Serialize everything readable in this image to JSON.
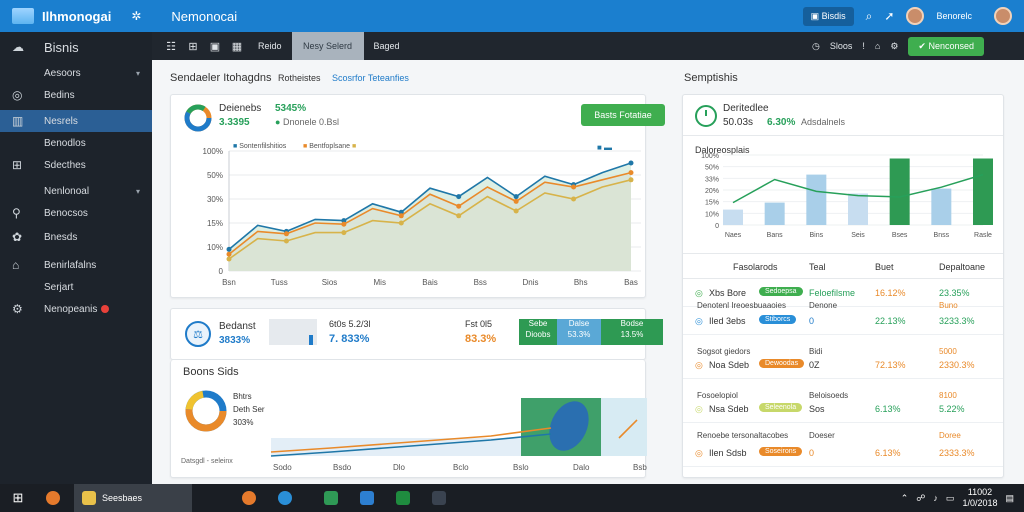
{
  "titlebar": {
    "app_name": "Ilhmonogai",
    "window_title": "Nemonocai",
    "button_label": "Bisdis",
    "user_label": "Benorelc"
  },
  "sidebar": {
    "header": "Bisnis",
    "items": [
      {
        "label": "Aesoors"
      },
      {
        "label": "Bedins"
      },
      {
        "label": "Nesrels"
      },
      {
        "label": "Benodlos"
      },
      {
        "label": "Sdecthes"
      },
      {
        "label": "Nenlonoal"
      },
      {
        "label": "Benocsos"
      },
      {
        "label": "Bnesds"
      },
      {
        "label": "Benirlafalns"
      },
      {
        "label": "Serjart"
      },
      {
        "label": "Nenopeanis"
      }
    ]
  },
  "toolbar": {
    "tabs": [
      "Reido",
      "Nesy Selerd",
      "Baged"
    ],
    "right_label": "Sloos",
    "green_button": "Nenconsed"
  },
  "main": {
    "section_title": "Sendaeler Itohagdns",
    "section_link_1": "Rotheistes",
    "section_link_2": "Scosrfor Teteanfies",
    "chart_card": {
      "stat_title": "Deienebs",
      "stat_value": "5345%",
      "stat_value_2": "3.3395",
      "stat_note": "Dnonele 0.Bsl",
      "button_label": "Basts Fotatiae",
      "legend_1": "Sontenfilshitios",
      "legend_2": "Bentfoplsane"
    },
    "kpi_card": {
      "title": "Bedanst",
      "value": "3833%",
      "mid_label": "6t0s 5.2/3l",
      "mid_value": "7. 833%",
      "right_label": "Fst 0l5",
      "right_value": "83.3%",
      "tile_1": "Dioobs",
      "tile_2": "53.3%",
      "tile_3": "13.5%",
      "tile_1_top": "Sebe",
      "tile_2_top": "Dalse",
      "tile_3_top": "Bodse"
    },
    "lower_card": {
      "title": "Boons Sids",
      "donut_label_1": "Bhtrs",
      "donut_label_2": "Deth Ser",
      "donut_value": "303%",
      "axis_note": "Datsgdl - seleinx"
    }
  },
  "right_panel": {
    "title": "Semptishis",
    "stat_title": "Deritedlee",
    "stat_value": "50.03s",
    "stat_green": "6.30%",
    "stat_note": "Adsdalnels",
    "chart_title": "Daloreosplais",
    "table_headers": [
      "Fasolarods",
      "Teal",
      "Buet",
      "Depaltoane"
    ],
    "rows": [
      {
        "name": "Xbs Bore",
        "pill": "Sedoepsa",
        "status": "Feloefilsme",
        "val": "16.12%",
        "pct": "23.35%"
      },
      {
        "name": "Iled 3ebs",
        "pill": "Stiborcs",
        "status": "0",
        "val": "22.13%",
        "pct": "3233.3%"
      },
      {
        "name": "Noa Sdeb",
        "pill": "Dewoodas",
        "status": "0Z",
        "val": "72.13%",
        "pct": "2330.3%"
      },
      {
        "name": "Nsa Sdeb",
        "pill": "Seleenola",
        "status": "Sos",
        "val": "6.13%",
        "pct": "5.22%"
      },
      {
        "name": "Ilen Sdsb",
        "pill": "Soseirons",
        "status": "0",
        "val": "6.13%",
        "pct": "2333.3%"
      }
    ],
    "row_headers": [
      "Denotenl Ireoesbuaaoies",
      "Sogsot giedors",
      "Fosoelopiol",
      "Renoebe tersonaltacobes"
    ],
    "row_headers_2": [
      "Denone",
      "Bidi",
      "Beloisoeds",
      "Doeser"
    ],
    "row_headers_3": [
      "Buno",
      "5000",
      "8100",
      "Doree"
    ]
  },
  "chart_data": [
    {
      "type": "area",
      "x": [
        "Bsn",
        "Tuss",
        "Sios",
        "Mis",
        "Bais",
        "Bss",
        "Dnis",
        "Bhs",
        "Bas"
      ],
      "ylim": [
        0,
        1000
      ],
      "yticks": [
        "0",
        "10%",
        "15%",
        "30%",
        "50%",
        "100%"
      ],
      "series": [
        {
          "name": "Sontenfilshitios",
          "color": "#1f77a8",
          "values": [
            180,
            380,
            330,
            430,
            420,
            560,
            490,
            690,
            620,
            780,
            620,
            790,
            720,
            820,
            900
          ]
        },
        {
          "name": "Bentfoplsane",
          "color": "#e98a2a",
          "values": [
            140,
            330,
            310,
            400,
            390,
            520,
            460,
            640,
            540,
            700,
            580,
            740,
            700,
            760,
            820
          ]
        },
        {
          "name": "",
          "color": "#d7b34a",
          "values": [
            100,
            270,
            250,
            320,
            320,
            420,
            400,
            560,
            460,
            620,
            500,
            650,
            600,
            700,
            760
          ]
        }
      ]
    },
    {
      "type": "bar",
      "title": "Daloreosplais",
      "categories": [
        "Naes",
        "Bans",
        "Bins",
        "Seis",
        "Bses",
        "Bnss",
        "Rasle"
      ],
      "ylim": [
        0,
        1000
      ],
      "yticks": [
        "0",
        "10%",
        "15%",
        "20%",
        "33%",
        "50%",
        "100%"
      ],
      "series": [
        {
          "name": "",
          "values": [
            220,
            320,
            720,
            450,
            950,
            520,
            950
          ]
        }
      ]
    }
  ],
  "taskbar": {
    "active_app": "Seesbaes",
    "clock_time": "11002",
    "clock_date": "1/0/2018"
  }
}
